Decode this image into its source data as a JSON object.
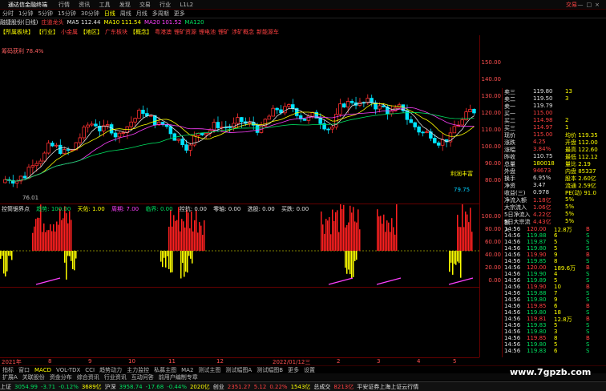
{
  "titlebar": {
    "app": "通达信金融终端",
    "menu": [
      "行情",
      "资讯",
      "工具",
      "发现",
      "交易",
      "行业",
      "L1L2"
    ],
    "trade": "交易"
  },
  "periodbar": {
    "items": [
      "分时",
      "1分钟",
      "5分钟",
      "15分钟",
      "30分钟",
      "日线",
      "周线",
      "月线",
      "多周期",
      "更多"
    ],
    "selected": "日线"
  },
  "stockbar": {
    "name": "融捷股份(日线)",
    "tag": "庄道龙头",
    "ma5": "MA5 112.44",
    "ma10": "MA10 111.54",
    "ma20": "MA20 101.52",
    "ma120": "MA120"
  },
  "tagbar": {
    "items": [
      "【所属板块】",
      "【行业】",
      "小金属",
      "【地区】",
      "广东板块",
      "【概念】",
      "粤港澳",
      "锂矿资源",
      "锂电池",
      "锂矿",
      "涉矿概念",
      "新能源车"
    ]
  },
  "chart_label": "筹码获利 78.4%",
  "price_axis": [
    "150.00",
    "140.00",
    "130.00",
    "120.00",
    "110.00",
    "100.00",
    "90.00",
    "80.00"
  ],
  "annotations": {
    "high": "129.81",
    "low": "76.01",
    "last": "79.75"
  },
  "ind1": {
    "title": "控筒锯界点",
    "fields": [
      {
        "label": "趋势: 100.00",
        "cls": "dn"
      },
      {
        "label": "天佑: 1.00",
        "cls": "yl"
      },
      {
        "label": "周期: 7.00",
        "cls": "mg"
      },
      {
        "label": "临界: 0.00",
        "cls": "dn"
      },
      {
        "label": "控抗: 0.00",
        "cls": "wh"
      },
      {
        "label": "零轴: 0.00",
        "cls": "wh"
      },
      {
        "label": "选股: 0.00",
        "cls": "wh"
      },
      {
        "label": "买跌: 0.00",
        "cls": "wh"
      }
    ],
    "axis": [
      "100.00",
      "80.00",
      "60.00",
      "40.00",
      "20.00",
      "0.00"
    ]
  },
  "quote": [
    {
      "k": "卖三",
      "v": "119.80",
      "s": "13",
      "c": "wh"
    },
    {
      "k": "卖二",
      "v": "119.50",
      "s": "3",
      "c": "wh"
    },
    {
      "k": "卖一",
      "v": "119.79",
      "s": "",
      "c": "wh"
    },
    {
      "k": "买一",
      "v": "115.00",
      "s": "",
      "c": "up"
    },
    {
      "k": "买二",
      "v": "114.98",
      "s": "2",
      "c": "up"
    },
    {
      "k": "买三",
      "v": "114.97",
      "s": "1",
      "c": "up"
    },
    {
      "k": "现价",
      "v": "115.00",
      "s": "均价 119.35",
      "c": "up"
    },
    {
      "k": "涨跌",
      "v": "4.25",
      "s": "开盘 112.00",
      "c": "up"
    },
    {
      "k": "涨幅",
      "v": "3.84%",
      "s": "最高 122.60",
      "c": "up"
    },
    {
      "k": "昨收",
      "v": "110.75",
      "s": "最低 112.12",
      "c": "wh"
    },
    {
      "k": "总量",
      "v": "180018",
      "s": "量比 2.19",
      "c": "yl"
    },
    {
      "k": "外盘",
      "v": "94673",
      "s": "内盘 85337",
      "c": "up"
    },
    {
      "k": "换手",
      "v": "6.95%",
      "s": "股本 2.60亿",
      "c": "wh"
    },
    {
      "k": "净资",
      "v": "3.47",
      "s": "流通 2.59亿",
      "c": "wh"
    },
    {
      "k": "收益(三)",
      "v": "0.978",
      "s": "PE(动) 91.0",
      "c": "wh"
    },
    {
      "k": "净流入额",
      "v": "1.18亿",
      "s": "5%",
      "c": "up"
    },
    {
      "k": "大宗流入",
      "v": "1.06亿",
      "s": "5%",
      "c": "up"
    },
    {
      "k": "5日净流入额",
      "v": "4.22亿",
      "s": "5%",
      "c": "up"
    },
    {
      "k": "5日大宗流入",
      "v": "4.43亿",
      "s": "5%",
      "c": "up"
    }
  ],
  "ticks": [
    {
      "t": "14:56",
      "p": "120.00",
      "v": "12.8万",
      "c": "up"
    },
    {
      "t": "14:56",
      "p": "119.88",
      "v": "6",
      "c": "dn"
    },
    {
      "t": "14:56",
      "p": "119.87",
      "v": "5",
      "c": "dn"
    },
    {
      "t": "14:56",
      "p": "119.80",
      "v": "5",
      "c": "dn"
    },
    {
      "t": "14:56",
      "p": "119.90",
      "v": "9",
      "c": "up"
    },
    {
      "t": "14:56",
      "p": "119.85",
      "v": "8",
      "c": "dn"
    },
    {
      "t": "14:56",
      "p": "120.00",
      "v": "189.6万",
      "c": "up"
    },
    {
      "t": "14:56",
      "p": "119.90",
      "v": "4",
      "c": "dn"
    },
    {
      "t": "14:56",
      "p": "119.89",
      "v": "5",
      "c": "dn"
    },
    {
      "t": "14:56",
      "p": "119.90",
      "v": "10",
      "c": "up"
    },
    {
      "t": "14:56",
      "p": "119.88",
      "v": "7",
      "c": "dn"
    },
    {
      "t": "14:56",
      "p": "119.80",
      "v": "9",
      "c": "dn"
    },
    {
      "t": "14:56",
      "p": "119.85",
      "v": "6",
      "c": "up"
    },
    {
      "t": "14:56",
      "p": "119.80",
      "v": "18",
      "c": "dn"
    },
    {
      "t": "14:56",
      "p": "119.81",
      "v": "12.8万",
      "c": "up"
    },
    {
      "t": "14:56",
      "p": "119.83",
      "v": "5",
      "c": "dn"
    },
    {
      "t": "14:56",
      "p": "119.80",
      "v": "3",
      "c": "dn"
    },
    {
      "t": "14:56",
      "p": "119.85",
      "v": "8",
      "c": "up"
    },
    {
      "t": "14:56",
      "p": "119.80",
      "v": "5",
      "c": "dn"
    },
    {
      "t": "14:56",
      "p": "119.83",
      "v": "6",
      "c": "dn"
    },
    {
      "t": "14:56",
      "p": "119.88",
      "v": "7",
      "c": "up"
    },
    {
      "t": "14:56",
      "p": "119.85",
      "v": "12.9万",
      "c": "up"
    },
    {
      "t": "14:56",
      "p": "119.85",
      "v": "5",
      "c": "dn"
    },
    {
      "t": "14:56",
      "p": "119.80",
      "v": "9",
      "c": "dn"
    },
    {
      "t": "14:56",
      "p": "119.80",
      "v": "12.9万",
      "c": "up"
    },
    {
      "t": "14:56",
      "p": "119.90",
      "v": "12",
      "c": "up"
    },
    {
      "t": "14:56",
      "p": "119.85",
      "v": "8",
      "c": "dn"
    },
    {
      "t": "14:56",
      "p": "119.80",
      "v": "13.8万",
      "c": "up"
    },
    {
      "t": "14:56",
      "p": "119.80",
      "v": "8",
      "c": "up"
    },
    {
      "t": "14:56",
      "p": "120.00",
      "v": "13.8万",
      "c": "up"
    }
  ],
  "timeaxis": [
    "2021年",
    "8",
    "9",
    "10",
    "11",
    "12",
    "2022/01/12三",
    "2",
    "3",
    "4",
    "5"
  ],
  "tabs": [
    "指标",
    "窗口",
    "MACD",
    "VOL-TDX",
    "CCI",
    "趋势动力",
    "主力监控",
    "私募主图",
    "MA2",
    "测试主图",
    "测试幅图A",
    "测试幅图B",
    "更多",
    "设置"
  ],
  "tabs_active": "MACD",
  "tabs2": [
    "扩展A",
    "关联股份",
    "资金分布",
    "综合资讯",
    "行业资讯",
    "互动问答",
    "前用户编制专章"
  ],
  "status": [
    {
      "k": "上证",
      "v": "3054.99",
      "d": "-3.71",
      "p": "-0.12%",
      "a": "3689亿"
    },
    {
      "k": "沪深",
      "v": "3958.74",
      "d": "-17.68",
      "p": "-0.44%",
      "a": "2020亿"
    },
    {
      "k": "创业",
      "v": "2351.27",
      "d": "5.12",
      "p": "0.22%",
      "a": "1543亿"
    },
    {
      "k": "总成交",
      "v": "8213亿",
      "d": "",
      "p": "",
      "a": ""
    }
  ],
  "status_right": "平安证券上海上证云行情",
  "watermark": "www.7gpzb.com",
  "bubble_label": "利润丰富"
}
